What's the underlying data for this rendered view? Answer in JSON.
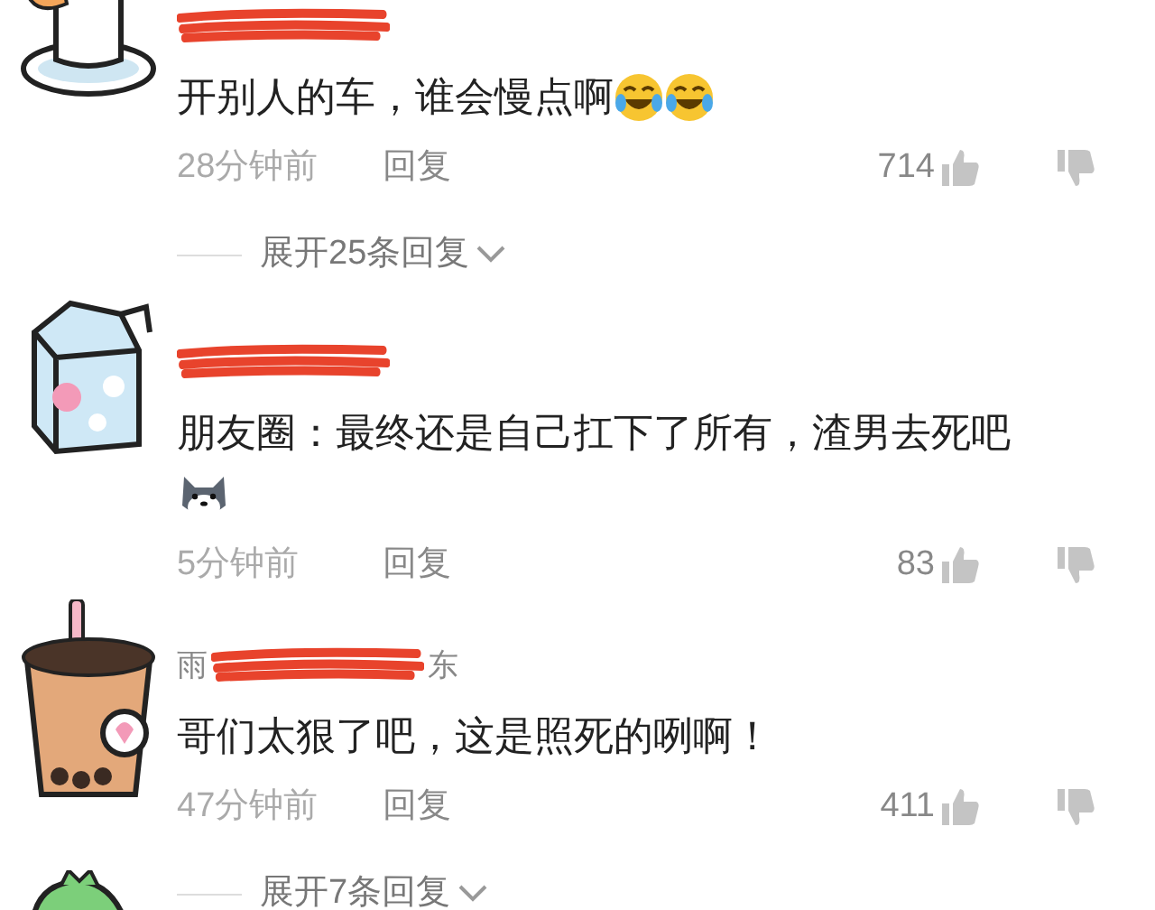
{
  "comments": [
    {
      "avatar": {
        "kind": "duck"
      },
      "text": "开别人的车，谁会慢点啊",
      "emojis": [
        {
          "kind": "laugh-cry"
        },
        {
          "kind": "laugh-cry"
        }
      ],
      "emoji_line": false,
      "time": "28分钟前",
      "reply": "回复",
      "likes": "714",
      "expand": "展开25条回复"
    },
    {
      "avatar": {
        "kind": "milk"
      },
      "text": "朋友圈：最终还是自己扛下了所有，渣男去死吧",
      "emojis": [
        {
          "kind": "dog"
        }
      ],
      "emoji_line": true,
      "time": "5分钟前",
      "reply": "回复",
      "likes": "83"
    },
    {
      "avatar": {
        "kind": "tea"
      },
      "author": "雨",
      "location": "东",
      "text": "哥们太狠了吧，这是照死的咧啊！",
      "time": "47分钟前",
      "reply": "回复",
      "likes": "411",
      "expand": "展开7条回复"
    }
  ],
  "next_avatar": {
    "kind": "dino"
  }
}
